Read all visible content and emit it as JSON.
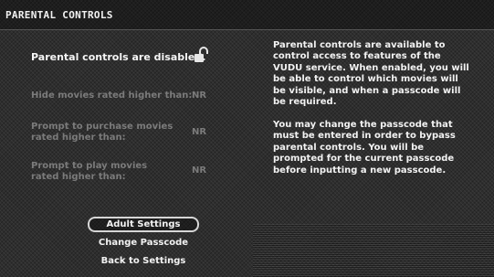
{
  "header": {
    "title": "PARENTAL CONTROLS"
  },
  "status": {
    "text": "Parental controls are disabled.",
    "icon": "unlocked-padlock-icon"
  },
  "settings": [
    {
      "label": "Hide movies rated higher than:",
      "value": "NR"
    },
    {
      "label": "Prompt to purchase movies rated higher than:",
      "value": "NR"
    },
    {
      "label": "Prompt to play movies rated higher than:",
      "value": "NR"
    }
  ],
  "buttons": {
    "adult_settings": "Adult Settings",
    "change_passcode": "Change Passcode",
    "back_to_settings": "Back to Settings"
  },
  "info": {
    "paragraph1": "Parental controls are available to control access to features of the VUDU service. When enabled, you will be able to control which movies will be visible, and when a passcode will be required.",
    "paragraph2": "You may change the passcode that must be entered in order to bypass parental controls. You will be prompted for the current passcode before inputting a new passcode."
  },
  "colors": {
    "text": "#f2f2f2",
    "disabled_text": "#7b7b7b",
    "background": "#2e2e2e"
  }
}
